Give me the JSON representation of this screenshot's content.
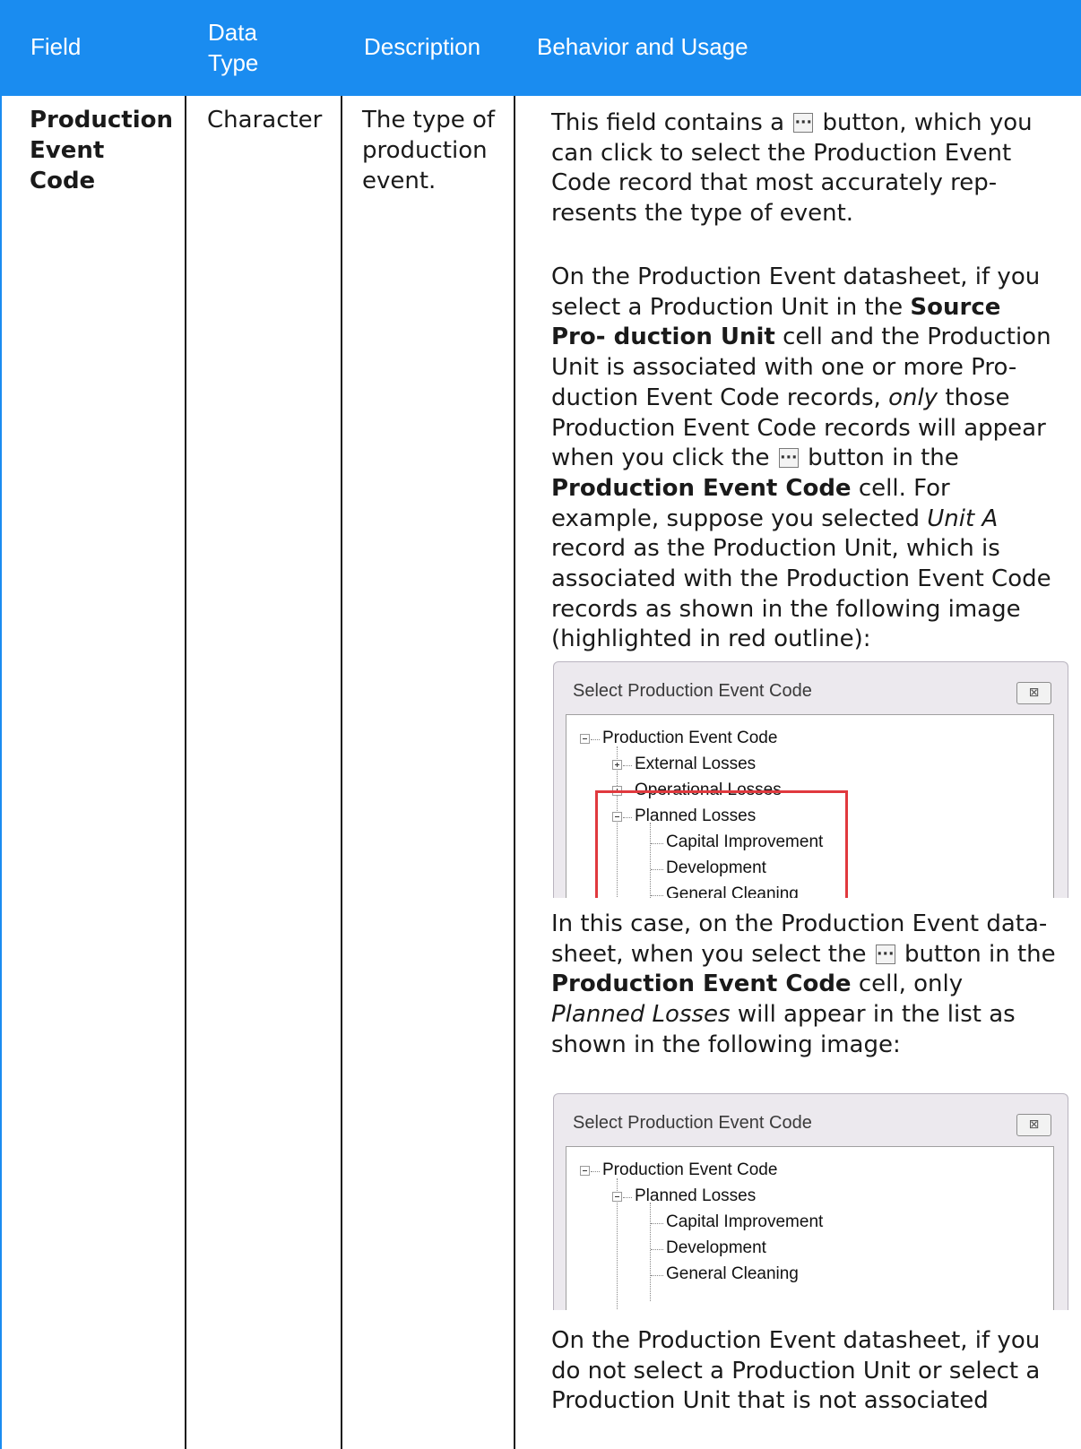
{
  "header": {
    "col_field": "Field",
    "col_data_type": "Data Type",
    "col_description": "Description",
    "col_behavior": "Behavior and Usage"
  },
  "row": {
    "field": "Production Event Code",
    "data_type": "Character",
    "description": "The type of production event."
  },
  "behavior": {
    "p1_a": "This field contains a",
    "p1_b": "button, which you can click to select the Production Event Code record that most accurately rep- resents the type of event.",
    "p2_a": "On the Production Event datasheet, if you select a Production Unit in the",
    "p2_b": "Source Pro- duction Unit",
    "p2_c": "cell and the Production Unit is associated with one or more Pro- duction Event Code records,",
    "p2_d": "only",
    "p2_e": "those Production Event Code records will appear when you click the",
    "p2_f": "button in the",
    "p2_g": "Production Event Code",
    "p2_h": "cell. For example, suppose you selected",
    "p2_i": "Unit A",
    "p2_j": "record as the Production Unit, which is associated with the Production Event Code records as shown in the following image (highlighted in red outline):",
    "p3_a": "In this case, on the Production Event data- sheet, when you select the",
    "p3_b": "button in the",
    "p3_c": "Production Event Code",
    "p3_d": "cell, only",
    "p3_e": "Planned Losses",
    "p3_f": "will appear in the list as shown in the following image:",
    "p4": "On the Production Event datasheet, if you do not select a Production Unit or select a Production Unit that is not associated"
  },
  "dialog1": {
    "title": "Select Production Event Code",
    "close": "⊠",
    "nodes": [
      "Production Event Code",
      "External Losses",
      "Operational Losses",
      "Planned Losses",
      "Capital Improvement",
      "Development",
      "General Cleaning"
    ]
  },
  "dialog2": {
    "title": "Select Production Event Code",
    "close": "⊠",
    "nodes": [
      "Production Event Code",
      "Planned Losses",
      "Capital Improvement",
      "Development",
      "General Cleaning"
    ]
  },
  "colors": {
    "header_bg": "#1a8cf0",
    "highlight_outline": "#e0393e"
  }
}
